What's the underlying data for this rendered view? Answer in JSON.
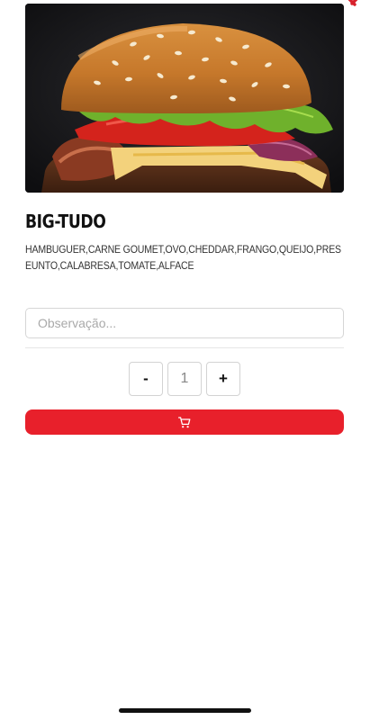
{
  "colors": {
    "accent": "#e8202b",
    "close": "#d7202b",
    "border": "#d6d6d6"
  },
  "product": {
    "image_alt": "burger-photo",
    "title": "BIG-TUDO",
    "description": "HAMBUGUER,CARNE GOUMET,OVO,CHEDDAR,FRANGO,QUEIJO,PRESEUNTO,CALABRESA,TOMATE,ALFACE"
  },
  "notes": {
    "placeholder": "Observação...",
    "value": ""
  },
  "quantity": {
    "minus_label": "-",
    "value": "1",
    "plus_label": "+"
  },
  "cart_button": {
    "icon": "cart-icon"
  },
  "close_button": {
    "icon": "close-icon"
  }
}
